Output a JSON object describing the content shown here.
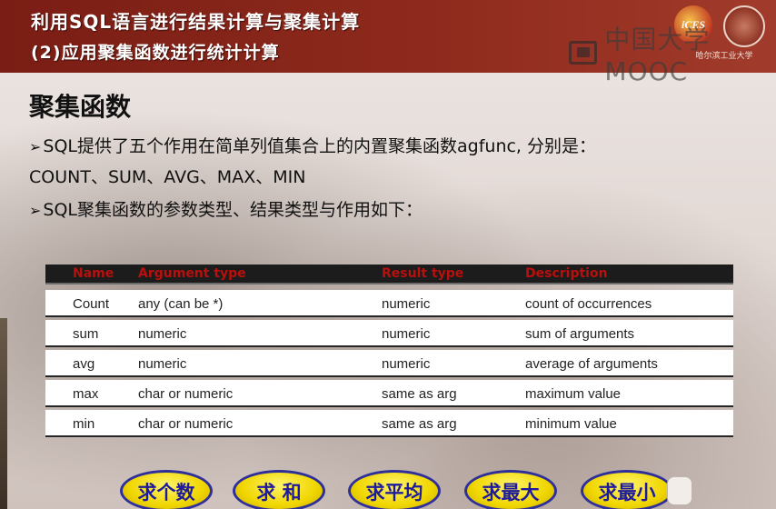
{
  "header": {
    "title_line1": "利用SQL语言进行结果计算与聚集计算",
    "title_line2": "(2)应用聚集函数进行统计计算",
    "logo_text": "iCES",
    "seal_caption": "哈尔滨工业大学",
    "watermark": "中国大学MOOC"
  },
  "slide": {
    "heading": "聚集函数",
    "bullets": [
      "SQL提供了五个作用在简单列值集合上的内置聚集函数agfunc, 分别是：",
      "COUNT、SUM、AVG、MAX、MIN",
      "SQL聚集函数的参数类型、结果类型与作用如下："
    ],
    "bullet_marker": "➢"
  },
  "table": {
    "columns": [
      "Name",
      "Argument type",
      "Result type",
      "Description"
    ],
    "rows": [
      [
        "Count",
        "any (can be *)",
        "numeric",
        "count of occurrences"
      ],
      [
        "sum",
        "numeric",
        "numeric",
        "sum of arguments"
      ],
      [
        "avg",
        "numeric",
        "numeric",
        "average of arguments"
      ],
      [
        "max",
        "char or numeric",
        "same as arg",
        "maximum value"
      ],
      [
        "min",
        "char or numeric",
        "same as arg",
        "minimum value"
      ]
    ]
  },
  "buttons": {
    "count": "求个数",
    "sum": "求 和",
    "avg": "求平均",
    "max": "求最大",
    "min": "求最小"
  },
  "colors": {
    "header_bg": "#8e2a1d",
    "table_header_text": "#b8100c",
    "button_fill": "#f0d600",
    "button_text": "#1e1a9c"
  }
}
